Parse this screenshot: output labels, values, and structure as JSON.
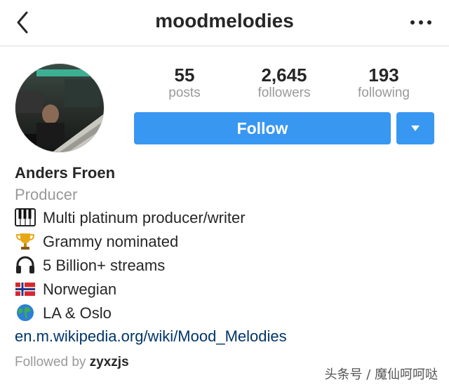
{
  "header": {
    "title": "moodmelodies"
  },
  "profile": {
    "name": "Anders Froen",
    "category": "Producer",
    "stats": [
      {
        "value": "55",
        "label": "posts"
      },
      {
        "value": "2,645",
        "label": "followers"
      },
      {
        "value": "193",
        "label": "following"
      }
    ],
    "follow_label": "Follow",
    "bio": [
      {
        "icon": "piano-keys-icon",
        "text": "Multi platinum producer/writer"
      },
      {
        "icon": "trophy-icon",
        "text": "Grammy nominated"
      },
      {
        "icon": "headphones-icon",
        "text": "5 Billion+ streams"
      },
      {
        "icon": "norway-flag-icon",
        "text": "Norwegian"
      },
      {
        "icon": "globe-icon",
        "text": "LA & Oslo"
      }
    ],
    "link": "en.m.wikipedia.org/wiki/Mood_Melodies",
    "followed_by_label": "Followed by",
    "followed_by_user": "zyxzjs"
  },
  "watermark": "头条号 / 魔仙呵呵哒",
  "colors": {
    "accent": "#3897f0",
    "muted": "#999999",
    "link": "#003569"
  }
}
